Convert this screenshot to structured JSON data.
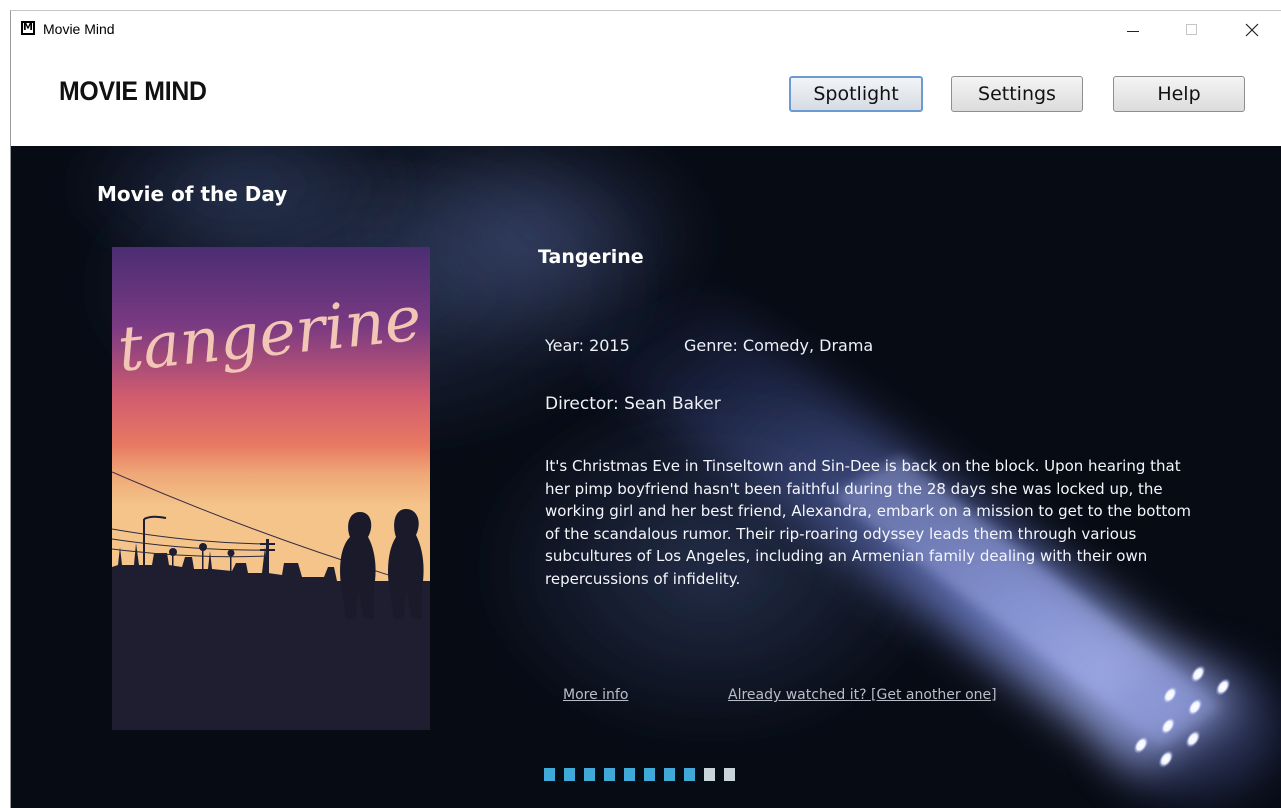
{
  "window": {
    "title": "Movie Mind",
    "icon": "M"
  },
  "header": {
    "brand": "MOVIE MIND",
    "nav": {
      "spotlight": "Spotlight",
      "settings": "Settings",
      "help": "Help"
    }
  },
  "section": {
    "title": "Movie of the Day"
  },
  "movie": {
    "poster_title": "tangerine",
    "title": "Tangerine",
    "year": "Year: 2015",
    "genre": "Genre: Comedy, Drama",
    "director": "Director: Sean Baker",
    "synopsis": "It's Christmas Eve in Tinseltown and Sin-Dee is back on the block. Upon hearing that her pimp boyfriend hasn't been faithful during the 28 days she was locked up, the working girl and her best friend, Alexandra, embark on a mission to get to the bottom of the scandalous rumor. Their rip-roaring odyssey leads them through various subcultures of Los Angeles, including an Armenian family dealing with their own repercussions of infidelity."
  },
  "links": {
    "more_info": "More info",
    "get_another": "Already watched it? [Get another one]"
  },
  "pager": {
    "total": 10,
    "active_count": 8,
    "active_color": "#3fa9d8",
    "inactive_color": "#c9d3dc"
  },
  "colors": {
    "stage_background": "#070b14",
    "spotlight_beam": "#8ea2ff"
  }
}
